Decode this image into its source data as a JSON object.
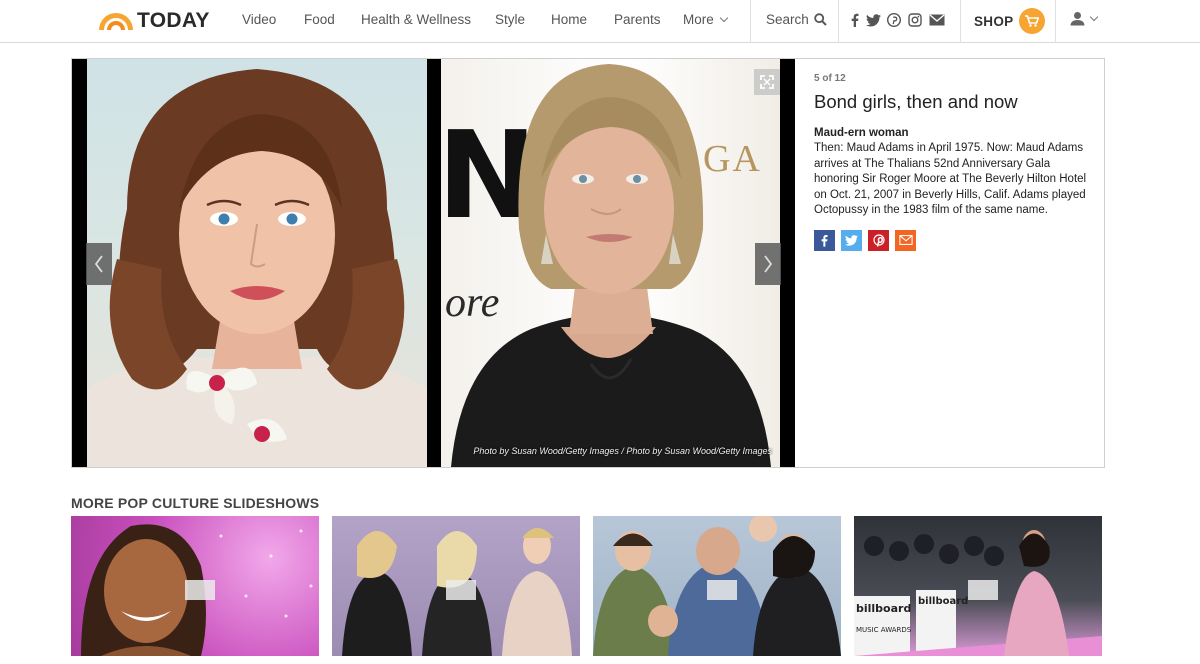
{
  "brand": {
    "name": "TODAY",
    "logo_color": "#f7a532"
  },
  "nav": {
    "links": [
      "Video",
      "Food",
      "Health & Wellness",
      "Style",
      "Home",
      "Parents",
      "More"
    ],
    "search_label": "Search",
    "social_icons": [
      "facebook-icon",
      "twitter-icon",
      "pinterest-icon",
      "instagram-icon",
      "email-icon"
    ],
    "shop_label": "SHOP"
  },
  "slideshow": {
    "counter": "5 of 12",
    "title": "Bond girls, then and now",
    "subtitle": "Maud-ern woman",
    "body": "Then: Maud Adams in April 1975. Now: Maud Adams arrives at The Thalians 52nd Anniversary Gala honoring Sir Roger Moore at The Beverly Hilton Hotel on Oct. 21, 2007 in Beverly Hills, Calif. Adams played Octopussy in the 1983 film of the same name.",
    "photo_credit": "Photo by Susan Wood/Getty Images / Photo by Susan Wood/Getty Images",
    "backdrop_text": {
      "letter": "N",
      "ga": "GA",
      "ore": "ore"
    },
    "share": [
      {
        "icon": "facebook-icon",
        "color": "#3b5998"
      },
      {
        "icon": "twitter-icon",
        "color": "#55acee"
      },
      {
        "icon": "pinterest-icon",
        "color": "#cb2027"
      },
      {
        "icon": "email-icon",
        "color": "#f26522"
      }
    ]
  },
  "more": {
    "heading": "MORE POP CULTURE SLIDESHOWS",
    "thumbnails": [
      {
        "overlay_text": []
      },
      {
        "overlay_text": []
      },
      {
        "overlay_text": []
      },
      {
        "overlay_text": [
          "billboard",
          "billboard",
          "MUSIC AWARDS"
        ]
      }
    ]
  }
}
